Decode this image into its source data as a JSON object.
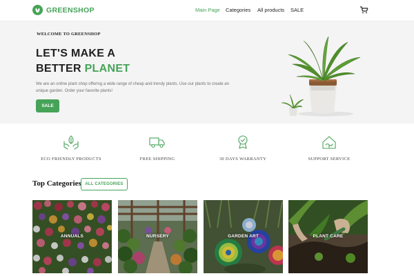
{
  "brand": {
    "name": "GREENSHOP",
    "accent": "#46a358"
  },
  "nav": {
    "items": [
      {
        "label": "Main Page",
        "active": true
      },
      {
        "label": "Categories",
        "active": false
      },
      {
        "label": "All products",
        "active": false
      },
      {
        "label": "SALE",
        "active": false
      }
    ],
    "cart_icon": "cart-icon"
  },
  "hero": {
    "welcome": "WELCOME TO GREENSHOP",
    "title_line1": "LET'S MAKE A",
    "title_line2_prefix": "BETTER",
    "title_line2_accent": "PLANET",
    "description": "We are an online plant shop offering a wide range of cheap and trendy plants. Use our plants to create an unique garden. Order your favorite plants!",
    "button": "SALE"
  },
  "features": [
    {
      "icon": "eco-hands-icon",
      "label": "ECO FRIENDLY PRODUCTS"
    },
    {
      "icon": "truck-icon",
      "label": "FREE SHIPPING"
    },
    {
      "icon": "medal-icon",
      "label": "30 DAYS WARRANTY"
    },
    {
      "icon": "support-icon",
      "label": "SUPPORT SERVICE"
    }
  ],
  "categories": {
    "heading": "Top Categories",
    "button": "ALL CATEGORIES",
    "items": [
      {
        "label": "ANNUALS"
      },
      {
        "label": "NURSERY"
      },
      {
        "label": "GARDEN ART"
      },
      {
        "label": "PLANT CARE"
      }
    ]
  }
}
